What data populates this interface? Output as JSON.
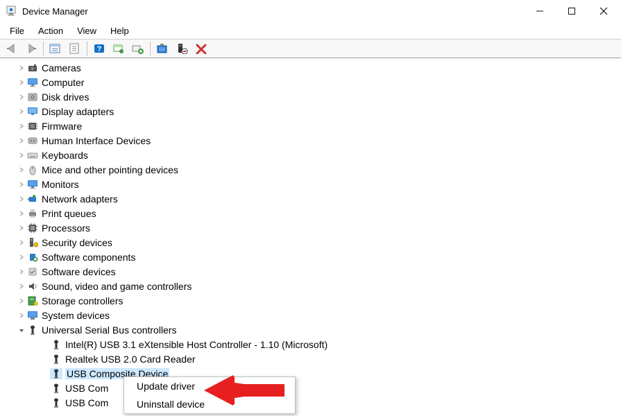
{
  "window": {
    "title": "Device Manager"
  },
  "menu": {
    "file": "File",
    "action": "Action",
    "view": "View",
    "help": "Help"
  },
  "categories": [
    {
      "label": "Cameras",
      "icon": "camera"
    },
    {
      "label": "Computer",
      "icon": "monitor"
    },
    {
      "label": "Disk drives",
      "icon": "disk"
    },
    {
      "label": "Display adapters",
      "icon": "display"
    },
    {
      "label": "Firmware",
      "icon": "firmware"
    },
    {
      "label": "Human Interface Devices",
      "icon": "hid"
    },
    {
      "label": "Keyboards",
      "icon": "keyboard"
    },
    {
      "label": "Mice and other pointing devices",
      "icon": "mouse"
    },
    {
      "label": "Monitors",
      "icon": "monitor"
    },
    {
      "label": "Network adapters",
      "icon": "network"
    },
    {
      "label": "Print queues",
      "icon": "printer"
    },
    {
      "label": "Processors",
      "icon": "cpu"
    },
    {
      "label": "Security devices",
      "icon": "security"
    },
    {
      "label": "Software components",
      "icon": "software"
    },
    {
      "label": "Software devices",
      "icon": "software2"
    },
    {
      "label": "Sound, video and game controllers",
      "icon": "sound"
    },
    {
      "label": "Storage controllers",
      "icon": "storage"
    },
    {
      "label": "System devices",
      "icon": "system"
    }
  ],
  "usb": {
    "category": "Universal Serial Bus controllers",
    "children": [
      "Intel(R) USB 3.1 eXtensible Host Controller - 1.10 (Microsoft)",
      "Realtek USB 2.0 Card Reader",
      "USB Composite Device",
      "USB Com",
      "USB Com"
    ],
    "selected_index": 2
  },
  "context": {
    "update": "Update driver",
    "uninstall": "Uninstall device"
  }
}
